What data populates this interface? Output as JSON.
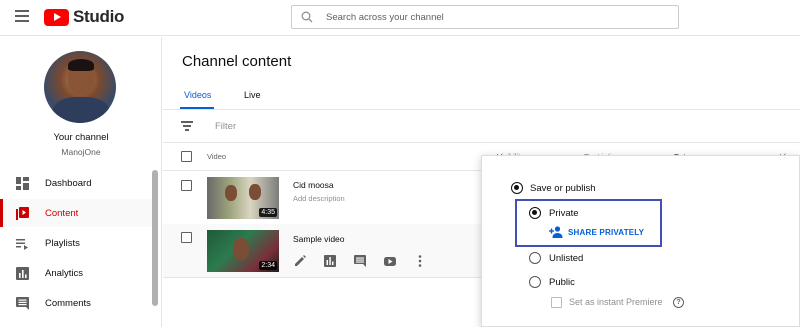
{
  "header": {
    "logo_text": "Studio",
    "search_placeholder": "Search across your channel"
  },
  "sidebar": {
    "channel_label": "Your channel",
    "channel_name": "ManojOne",
    "items": [
      {
        "label": "Dashboard",
        "icon": "dashboard-icon"
      },
      {
        "label": "Content",
        "icon": "content-icon",
        "active": true
      },
      {
        "label": "Playlists",
        "icon": "playlists-icon"
      },
      {
        "label": "Analytics",
        "icon": "analytics-icon"
      },
      {
        "label": "Comments",
        "icon": "comments-icon"
      }
    ]
  },
  "main": {
    "title": "Channel content",
    "tabs": [
      {
        "label": "Videos",
        "active": true
      },
      {
        "label": "Live"
      }
    ],
    "filter_label": "Filter",
    "columns": [
      "Video",
      "Visibility",
      "Restrictions",
      "Date ↓",
      "Views"
    ],
    "videos": [
      {
        "title": "Cid moosa",
        "description": "Add description",
        "duration": "4:35"
      },
      {
        "title": "Sample video",
        "description": "",
        "duration": "2:34"
      }
    ]
  },
  "visibility_popup": {
    "save_or_publish": "Save or publish",
    "private": "Private",
    "share_privately": "SHARE PRIVATELY",
    "unlisted": "Unlisted",
    "public": "Public",
    "instant_premiere": "Set as instant Premiere",
    "help": "?"
  },
  "colors": {
    "brand_red": "#ff0000",
    "active_red": "#cc0000",
    "link_blue": "#065fd4",
    "highlight_border": "#3f51b5"
  }
}
